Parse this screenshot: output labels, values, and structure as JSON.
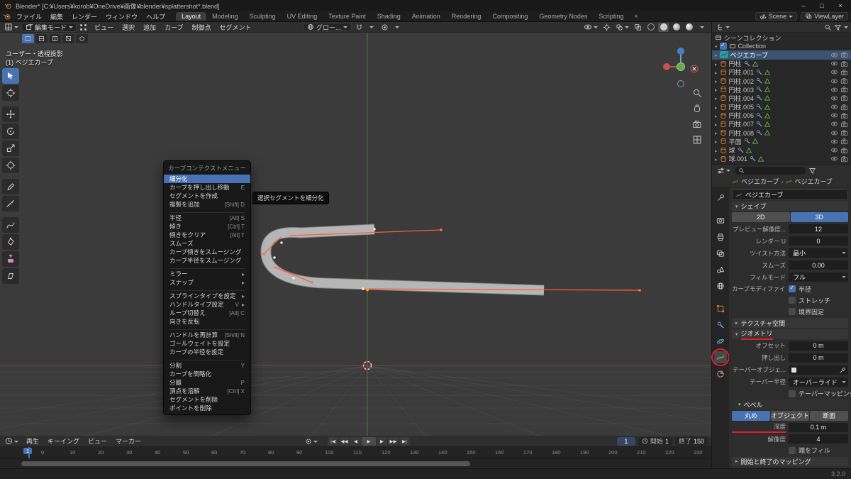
{
  "theme": {
    "accent": "#4772b3",
    "annotation_red": "#e11d28",
    "viewport_bg": "#3b3b3b",
    "header_bg": "#2e2e2e",
    "blender_orange": "#e8862d",
    "handle_orange": "#ff5e2e"
  },
  "titlebar": {
    "title": "Blender* [C:¥Users¥korob¥OneDrive¥画像¥blender¥splattershot*.blend]",
    "minimize": "–",
    "maximize": "□",
    "close": "×"
  },
  "menubar": {
    "menus": [
      "ファイル",
      "編集",
      "レンダー",
      "ウィンドウ",
      "ヘルプ"
    ],
    "workspaces": [
      {
        "label": "Layout",
        "active": true
      },
      {
        "label": "Modeling"
      },
      {
        "label": "Sculpting"
      },
      {
        "label": "UV Editing"
      },
      {
        "label": "Texture Paint"
      },
      {
        "label": "Shading"
      },
      {
        "label": "Animation"
      },
      {
        "label": "Rendering"
      },
      {
        "label": "Compositing"
      },
      {
        "label": "Geometry Nodes"
      },
      {
        "label": "Scripting"
      }
    ],
    "add_tab": "+",
    "scene_label": "Scene",
    "viewlayer_label": "ViewLayer"
  },
  "viewport_header": {
    "mode_label": "編集モード",
    "menus": [
      "ビュー",
      "選択",
      "追加",
      "カーブ",
      "制御点",
      "セグメント"
    ],
    "orientation_label": "グロー..."
  },
  "viewport": {
    "view_label": "ユーザー・透視投影",
    "object_label": "(1) ベジエカーブ",
    "tooltip": "選択セグメントを細分化"
  },
  "context_menu": {
    "title": "カーブコンテクストメニュー",
    "items": [
      {
        "label": "細分化",
        "highlight": true
      },
      {
        "label": "カーブを押し出し移動",
        "shortcut": "E"
      },
      {
        "label": "セグメントを作成"
      },
      {
        "label": "複製を追加",
        "shortcut": "[Shift] D"
      },
      {
        "sep": true
      },
      {
        "label": "半径",
        "shortcut": "[Alt] S"
      },
      {
        "label": "傾き",
        "shortcut": "[Ctrl] T"
      },
      {
        "label": "傾きをクリア",
        "shortcut": "[Alt] T"
      },
      {
        "label": "スムーズ"
      },
      {
        "label": "カーブ傾きをスムージング"
      },
      {
        "label": "カーブ半径をスムージング"
      },
      {
        "sep": true
      },
      {
        "label": "ミラー",
        "submenu": true
      },
      {
        "label": "スナップ",
        "submenu": true
      },
      {
        "sep": true
      },
      {
        "label": "スプラインタイプを設定",
        "submenu": true
      },
      {
        "label": "ハンドルタイプ設定",
        "shortcut": "V",
        "submenu": true
      },
      {
        "label": "ループ切替え",
        "shortc­ut": "[Alt] C",
        "shortcut": "[Alt] C"
      },
      {
        "label": "向きを反転"
      },
      {
        "sep": true
      },
      {
        "label": "ハンドルを再計算",
        "shortcut": "[Shift] N"
      },
      {
        "label": "ゴールウェイトを設定"
      },
      {
        "label": "カーブの半径を設定"
      },
      {
        "sep": true
      },
      {
        "label": "分割",
        "shortcut": "Y"
      },
      {
        "label": "カーブを簡略化"
      },
      {
        "label": "分離",
        "shortcut": "P"
      },
      {
        "label": "頂点を溶解",
        "shortcut": "[Ctrl] X"
      },
      {
        "label": "セグメントを削除"
      },
      {
        "label": "ポイントを削除"
      }
    ]
  },
  "outliner": {
    "scene_collection": "シーンコレクション",
    "collection": "Collection",
    "rows": [
      {
        "label": "ベジエカーブ",
        "curve": true,
        "selected": true
      },
      {
        "label": "円柱",
        "mesh": true
      },
      {
        "label": "円柱.001",
        "mesh": true
      },
      {
        "label": "円柱.002",
        "mesh": true
      },
      {
        "label": "円柱.003",
        "mesh": true
      },
      {
        "label": "円柱.004",
        "mesh": true
      },
      {
        "label": "円柱.005",
        "mesh": true
      },
      {
        "label": "円柱.006",
        "mesh": true
      },
      {
        "label": "円柱.007",
        "mesh": true
      },
      {
        "label": "円柱.008",
        "mesh": true
      },
      {
        "label": "平面",
        "mesh": true
      },
      {
        "label": "球",
        "mesh": true
      },
      {
        "label": "球.001",
        "mesh": true
      }
    ]
  },
  "properties": {
    "tabs": [
      "tool",
      "render",
      "output",
      "view-layer",
      "scene",
      "world",
      "object",
      "modifiers",
      "physics",
      "object-data",
      "material"
    ],
    "breadcrumb": {
      "root": "ベジエカーブ",
      "leaf": "ベジエカーブ"
    },
    "name_value": "ベジエカーブ",
    "shape": {
      "title": "シェイプ",
      "btn_2d": "2D",
      "btn_3d": "3D",
      "rows": [
        {
          "label": "プレビュー解像度...",
          "value": "12"
        },
        {
          "label": "レンダー U",
          "value": "0"
        },
        {
          "label": "ツイスト方法",
          "value": "最小",
          "dropdown": true
        },
        {
          "label": "スムーズ",
          "value": "0.00"
        },
        {
          "label": "フィルモード",
          "value": "フル",
          "dropdown": true
        }
      ],
      "checks": [
        {
          "left": "カーブモディファイ...",
          "label": "半径",
          "checked": true
        },
        {
          "label": "ストレッチ"
        },
        {
          "label": "境界固定"
        }
      ]
    },
    "texture_space_title": "テクスチャ空間",
    "geometry": {
      "title": "ジオメトリ",
      "rows": [
        {
          "label": "オフセット",
          "value": "0 m"
        },
        {
          "label": "押し出し",
          "value": "0 m"
        },
        {
          "label": "テーパーオブジェ...",
          "value": "",
          "eyedrop": true
        },
        {
          "label": "テーパー半径",
          "value": "オーバーライド",
          "dropdown": true
        }
      ],
      "taper_check": "テーパーマッピング",
      "bevel": {
        "title": "ベベル",
        "modes": [
          {
            "label": "丸め",
            "active": true
          },
          {
            "label": "オブジェクト"
          },
          {
            "label": "断面"
          }
        ],
        "depth_label": "深度",
        "depth_value": "0.1 m",
        "resolution_label": "解像度",
        "resolution_value": "4",
        "fill_check": "端をフィル"
      }
    },
    "bottom_partial": "開始と終了のマッピング"
  },
  "timeline": {
    "menus": [
      "再生",
      "キーイング",
      "ビュー",
      "マーカー"
    ],
    "playback": {
      "jump_start": "|◀",
      "key_prev": "◀◀",
      "play_rev": "◀",
      "play": "▶",
      "frame_next": "▶",
      "key_next": "▶▶",
      "jump_end": "▶|"
    },
    "current_frame": "1",
    "start_label": "開始",
    "start_value": "1",
    "end_label": "終了",
    "end_value": "150",
    "playhead": "1",
    "ruler": [
      "0",
      "10",
      "20",
      "30",
      "40",
      "50",
      "60",
      "70",
      "80",
      "90",
      "100",
      "110",
      "120",
      "130",
      "140",
      "150",
      "160",
      "170",
      "180",
      "190",
      "200",
      "210",
      "220",
      "230"
    ]
  },
  "statusbar": {
    "version": "3.2.0"
  }
}
